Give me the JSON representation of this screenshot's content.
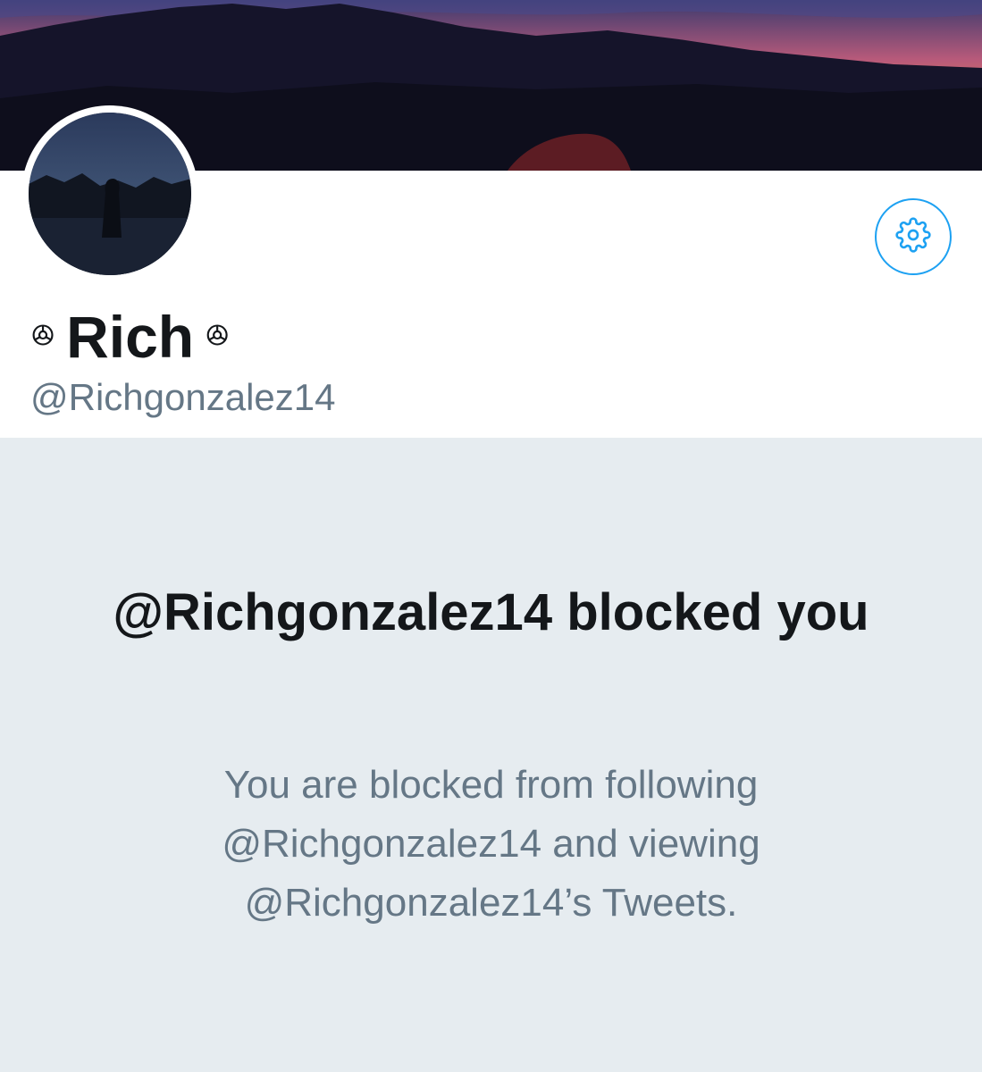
{
  "profile": {
    "display_name": "Rich",
    "name_decoration_left": "ꔮ",
    "name_decoration_right": "ꔮ",
    "handle": "@Richgonzalez14"
  },
  "icons": {
    "settings": "gear-icon"
  },
  "blocked": {
    "title": "@Richgonzalez14 blocked you",
    "description": "You are blocked from following @Richgonzalez14 and viewing @Richgonzalez14’s Tweets."
  },
  "colors": {
    "accent": "#1da1f2",
    "text_primary": "#14171a",
    "text_secondary": "#657786",
    "background": "#e6ecf0"
  }
}
